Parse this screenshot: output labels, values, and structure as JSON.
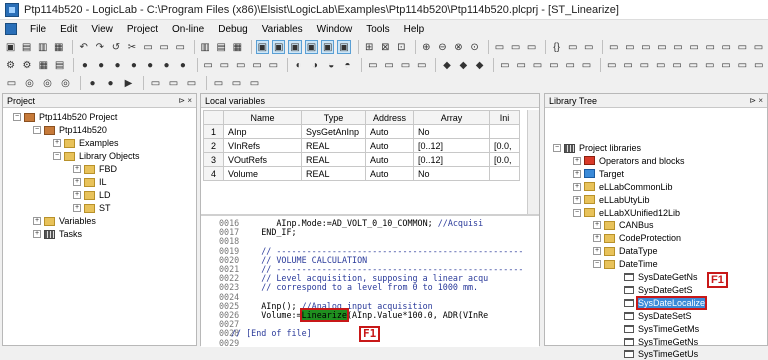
{
  "window": {
    "title": "Ptp114b520 - LogicLab - C:\\Program Files (x86)\\Elsist\\LogicLab\\Examples\\Ptp114b520\\Ptp114b520.plcprj - [ST_Linearize]"
  },
  "menu": [
    "File",
    "Edit",
    "View",
    "Project",
    "On-line",
    "Debug",
    "Variables",
    "Window",
    "Tools",
    "Help"
  ],
  "toolbar_glyphs": {
    "row1": [
      "▣",
      "▤",
      "▥",
      "▦",
      "",
      "↶",
      "↷",
      "↺",
      "✂",
      "▭",
      "▭",
      "▭",
      "",
      "▥",
      "▤",
      "▦",
      "",
      "▣",
      "▣",
      "▣",
      "▣",
      "▣",
      "▣",
      "",
      "⊞",
      "⊠",
      "⊡",
      "",
      "⊕",
      "⊖",
      "⊗",
      "⊙",
      "",
      "▭",
      "▭",
      "▭",
      "",
      "{}",
      "▭",
      "▭",
      "",
      "▭",
      "▭",
      "▭",
      "▭",
      "▭",
      "▭",
      "▭",
      "▭",
      "▭",
      "▭"
    ],
    "row2": [
      "⚙",
      "⚙",
      "▦",
      "▤",
      "",
      "●",
      "●",
      "●",
      "●",
      "●",
      "●",
      "●",
      "",
      "▭",
      "▭",
      "▭",
      "▭",
      "▭",
      "",
      "◐",
      "◑",
      "◒",
      "◓",
      "",
      "▭",
      "▭",
      "▭",
      "▭",
      "",
      "◆",
      "◆",
      "◆",
      "",
      "▭",
      "▭",
      "▭",
      "▭",
      "▭",
      "▭",
      "",
      "▭",
      "▭",
      "▭",
      "▭",
      "▭",
      "▭",
      "▭",
      "▭",
      "▭",
      "▭"
    ],
    "row3": [
      "▭",
      "◎",
      "◎",
      "◎",
      "",
      "●",
      "●",
      "▶",
      "",
      "▭",
      "▭",
      "▭",
      "",
      "▭",
      "▭",
      "▭"
    ]
  },
  "project_panel": {
    "title": "Project",
    "pin": "⊳ ×",
    "items": [
      {
        "label": "Ptp114b520 Project",
        "icon": "project-icon"
      },
      {
        "label": "Ptp114b520",
        "icon": "project-icon"
      },
      {
        "label": "Examples",
        "icon": "folder-icon"
      },
      {
        "label": "Library Objects",
        "icon": "folder-icon"
      },
      {
        "label": "FBD",
        "icon": "folder-icon"
      },
      {
        "label": "IL",
        "icon": "folder-icon"
      },
      {
        "label": "LD",
        "icon": "folder-icon"
      },
      {
        "label": "ST",
        "icon": "folder-icon"
      },
      {
        "label": "Variables",
        "icon": "folder-icon"
      },
      {
        "label": "Tasks",
        "icon": "grid-icon"
      }
    ]
  },
  "local_vars": {
    "title": "Local variables",
    "columns": [
      "Name",
      "Type",
      "Address",
      "Array",
      "Ini"
    ],
    "rows": [
      {
        "n": "1",
        "name": "AInp",
        "type": "SysGetAnInp",
        "address": "Auto",
        "array": "No",
        "init": ""
      },
      {
        "n": "2",
        "name": "VInRefs",
        "type": "REAL",
        "address": "Auto",
        "array": "[0..12]",
        "init": "[0.0,"
      },
      {
        "n": "3",
        "name": "VOutRefs",
        "type": "REAL",
        "address": "Auto",
        "array": "[0..12]",
        "init": "[0.0,"
      },
      {
        "n": "4",
        "name": "Volume",
        "type": "REAL",
        "address": "Auto",
        "array": "No",
        "init": ""
      }
    ]
  },
  "editor": {
    "lines": [
      {
        "no": "0016",
        "pre": "         AInp.Mode:=AD_VOLT_0_10_COMMON; ",
        "comment": "//Acquisi"
      },
      {
        "no": "0017",
        "pre": "      END_IF;",
        "comment": ""
      },
      {
        "no": "0018",
        "pre": "",
        "comment": ""
      },
      {
        "no": "0019",
        "pre": "      ",
        "comment": "// -------------------------------------------------"
      },
      {
        "no": "0020",
        "pre": "      ",
        "comment": "// VOLUME CALCULATION"
      },
      {
        "no": "0021",
        "pre": "      ",
        "comment": "// -------------------------------------------------"
      },
      {
        "no": "0022",
        "pre": "      ",
        "comment": "// Level acquisition, supposing a linear acqu"
      },
      {
        "no": "0023",
        "pre": "      ",
        "comment": "// correspond to a level from 0 to 1000 mm."
      },
      {
        "no": "0024",
        "pre": "",
        "comment": ""
      },
      {
        "no": "0025",
        "pre": "      AInp(); ",
        "comment": "//Analog input acquisition"
      },
      {
        "no": "0026",
        "pre": "      Volume:=",
        "highlight": "Linearize",
        "post": "(AInp.Value*100.0, ADR(VInRe"
      },
      {
        "no": "0027",
        "pre": "",
        "comment": ""
      },
      {
        "no": "0028",
        "pre": "",
        "comment": "// [End of file]"
      },
      {
        "no": "0029",
        "pre": "",
        "comment": ""
      }
    ],
    "callout": "F1"
  },
  "library_panel": {
    "title": "Library Tree",
    "pin": "⊳ ×",
    "items": [
      {
        "label": "Project libraries",
        "icon": "grid-icon"
      },
      {
        "label": "Operators and blocks",
        "icon": "book-icon"
      },
      {
        "label": "Target",
        "icon": "blue-icon"
      },
      {
        "label": "eLLabCommonLib",
        "icon": "folder-icon"
      },
      {
        "label": "eLLabUtyLib",
        "icon": "folder-icon"
      },
      {
        "label": "eLLabXUnified12Lib",
        "icon": "folder-icon"
      },
      {
        "label": "CANBus",
        "icon": "folder-icon"
      },
      {
        "label": "CodeProtection",
        "icon": "folder-icon"
      },
      {
        "label": "DataType",
        "icon": "folder-icon"
      },
      {
        "label": "DateTime",
        "icon": "folder-icon"
      },
      {
        "label": "SysDateGetNs",
        "icon": "function-icon"
      },
      {
        "label": "SysDateGetS",
        "icon": "function-icon"
      },
      {
        "label": "SysDateLocalize",
        "icon": "function-icon"
      },
      {
        "label": "SysDateSetS",
        "icon": "function-icon"
      },
      {
        "label": "SysTimeGetMs",
        "icon": "function-icon"
      },
      {
        "label": "SysTimeGetNs",
        "icon": "function-icon"
      },
      {
        "label": "SysTimeGetUs",
        "icon": "function-icon"
      }
    ],
    "callout": "F1"
  }
}
